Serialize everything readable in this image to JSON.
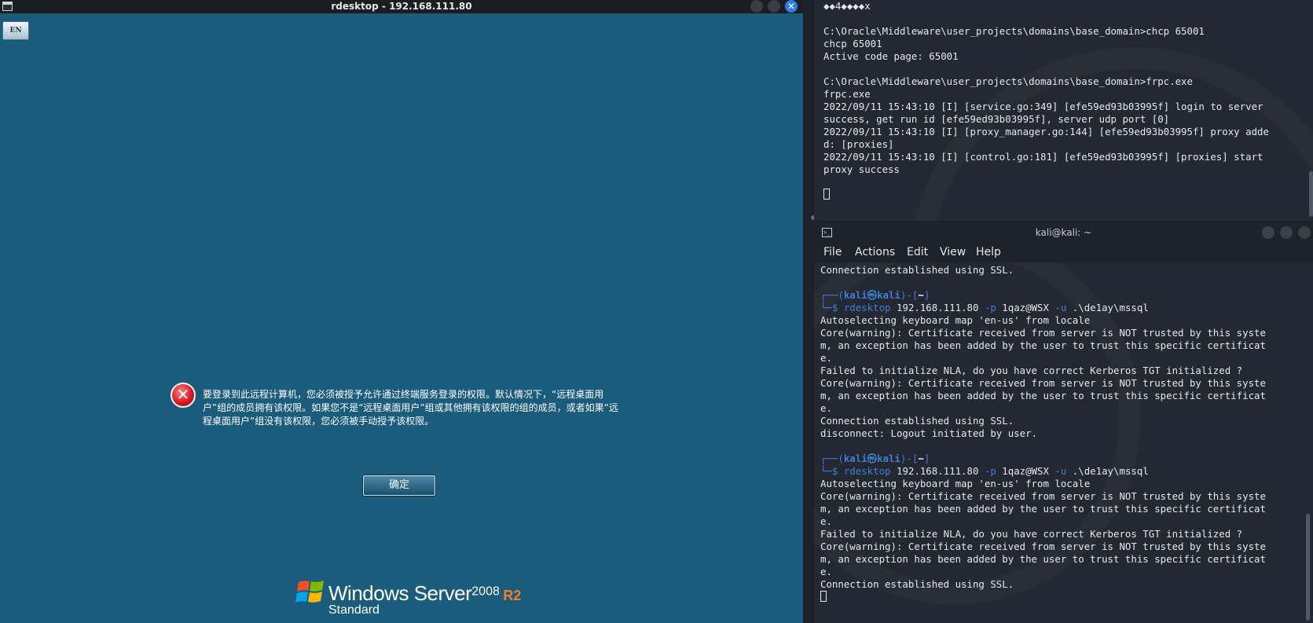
{
  "rdesktop": {
    "title": "rdesktop - 192.168.111.80",
    "close_glyph": "✕",
    "lang_indicator": "EN",
    "error_message": "要登录到此远程计算机，您必须被授予允许通过终端服务登录的权限。默认情况下，“远程桌面用户”组的成员拥有该权限。如果您不是“远程桌面用户”组或其他拥有该权限的组的成员，或者如果“远程桌面用户”组没有该权限，您必须被手动授予该权限。",
    "ok_button": "确定",
    "brand": {
      "name": "Windows Server",
      "version": "2008",
      "release": "R2",
      "edition": "Standard"
    },
    "error_icon_glyph": "✕"
  },
  "top_terminal": {
    "lines": [
      "◆◆4◆◆◆◆x",
      "",
      "C:\\Oracle\\Middleware\\user_projects\\domains\\base_domain>chcp 65001",
      "chcp 65001",
      "Active code page: 65001",
      "",
      "C:\\Oracle\\Middleware\\user_projects\\domains\\base_domain>frpc.exe",
      "frpc.exe",
      "2022/09/11 15:43:10 [I] [service.go:349] [efe59ed93b03995f] login to server",
      "success, get run id [efe59ed93b03995f], server udp port [0]",
      "2022/09/11 15:43:10 [I] [proxy_manager.go:144] [efe59ed93b03995f] proxy adde",
      "d: [proxies]",
      "2022/09/11 15:43:10 [I] [control.go:181] [efe59ed93b03995f] [proxies] start",
      "proxy success",
      ""
    ]
  },
  "kali_window": {
    "title": "kali@kali: ~",
    "menu": {
      "file": "File",
      "actions": "Actions",
      "edit": "Edit",
      "view": "View",
      "help": "Help"
    },
    "prompt": {
      "frame_top_left": "┌──(",
      "user_host": "kali㉿kali",
      "frame_mid": ")-[",
      "cwd": "~",
      "frame_end": "]",
      "frame_bottom": "└─$ ",
      "command": "rdesktop",
      "args_1": " 192.168.111.80 ",
      "opt_p": "-p",
      "args_2": " 1qaz@WSX ",
      "opt_u": "-u",
      "args_3": " .\\de1ay\\mssql"
    },
    "line_connection": "Connection established using SSL.",
    "block_1": [
      "Autoselecting keyboard map 'en-us' from locale",
      "Core(warning): Certificate received from server is NOT trusted by this syste",
      "m, an exception has been added by the user to trust this specific certificat",
      "e.",
      "Failed to initialize NLA, do you have correct Kerberos TGT initialized ?",
      "Core(warning): Certificate received from server is NOT trusted by this syste",
      "m, an exception has been added by the user to trust this specific certificat",
      "e.",
      "Connection established using SSL.",
      "disconnect: Logout initiated by user."
    ],
    "block_2": [
      "Autoselecting keyboard map 'en-us' from locale",
      "Core(warning): Certificate received from server is NOT trusted by this syste",
      "m, an exception has been added by the user to trust this specific certificat",
      "e.",
      "Failed to initialize NLA, do you have correct Kerberos TGT initialized ?",
      "Core(warning): Certificate received from server is NOT trusted by this syste",
      "m, an exception has been added by the user to trust this specific certificat",
      "e.",
      "Connection established using SSL."
    ]
  },
  "colors": {
    "rdp_desktop": "#1b5c7c",
    "terminal_bg": "#232832",
    "prompt_blue": "#3f7fd6",
    "brand_r2": "#ef7f22"
  }
}
